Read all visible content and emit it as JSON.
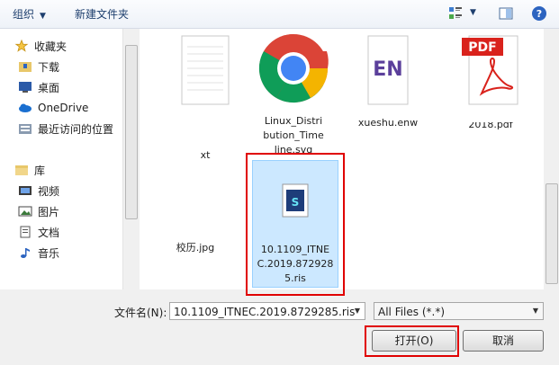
{
  "toolbar": {
    "organize": "组织",
    "new_folder": "新建文件夹"
  },
  "sidebar": {
    "favorites": "收藏夹",
    "items": [
      {
        "label": "下载",
        "icon": "downloads-folder-icon"
      },
      {
        "label": "桌面",
        "icon": "desktop-icon"
      },
      {
        "label": "OneDrive",
        "icon": "onedrive-cloud-icon"
      },
      {
        "label": "最近访问的位置",
        "icon": "recent-places-icon"
      }
    ],
    "library": "库",
    "library_items": [
      {
        "label": "视频",
        "icon": "video-library-icon"
      },
      {
        "label": "图片",
        "icon": "pictures-library-icon"
      },
      {
        "label": "文档",
        "icon": "documents-library-icon"
      },
      {
        "label": "音乐",
        "icon": "music-library-icon"
      }
    ]
  },
  "files": [
    {
      "name": "xt"
    },
    {
      "name": "Linux_Distribution_Timeline.svg"
    },
    {
      "name": "xueshu.enw"
    },
    {
      "name": "2018.pdf"
    },
    {
      "name": "校历.jpg"
    },
    {
      "name": "10.1109_ITNEC.2019.8729285.ris"
    }
  ],
  "pdf_badge": "PDF",
  "en_badge": "EN",
  "bottom": {
    "filename_label": "文件名(N):",
    "filename_value": "10.1109_ITNEC.2019.8729285.ris",
    "filter_value": "All Files (*.*)",
    "open_label": "打开(O)",
    "cancel_label": "取消"
  },
  "colors": {
    "highlight_red": "#e00000",
    "selection_blue": "#cce8ff"
  }
}
